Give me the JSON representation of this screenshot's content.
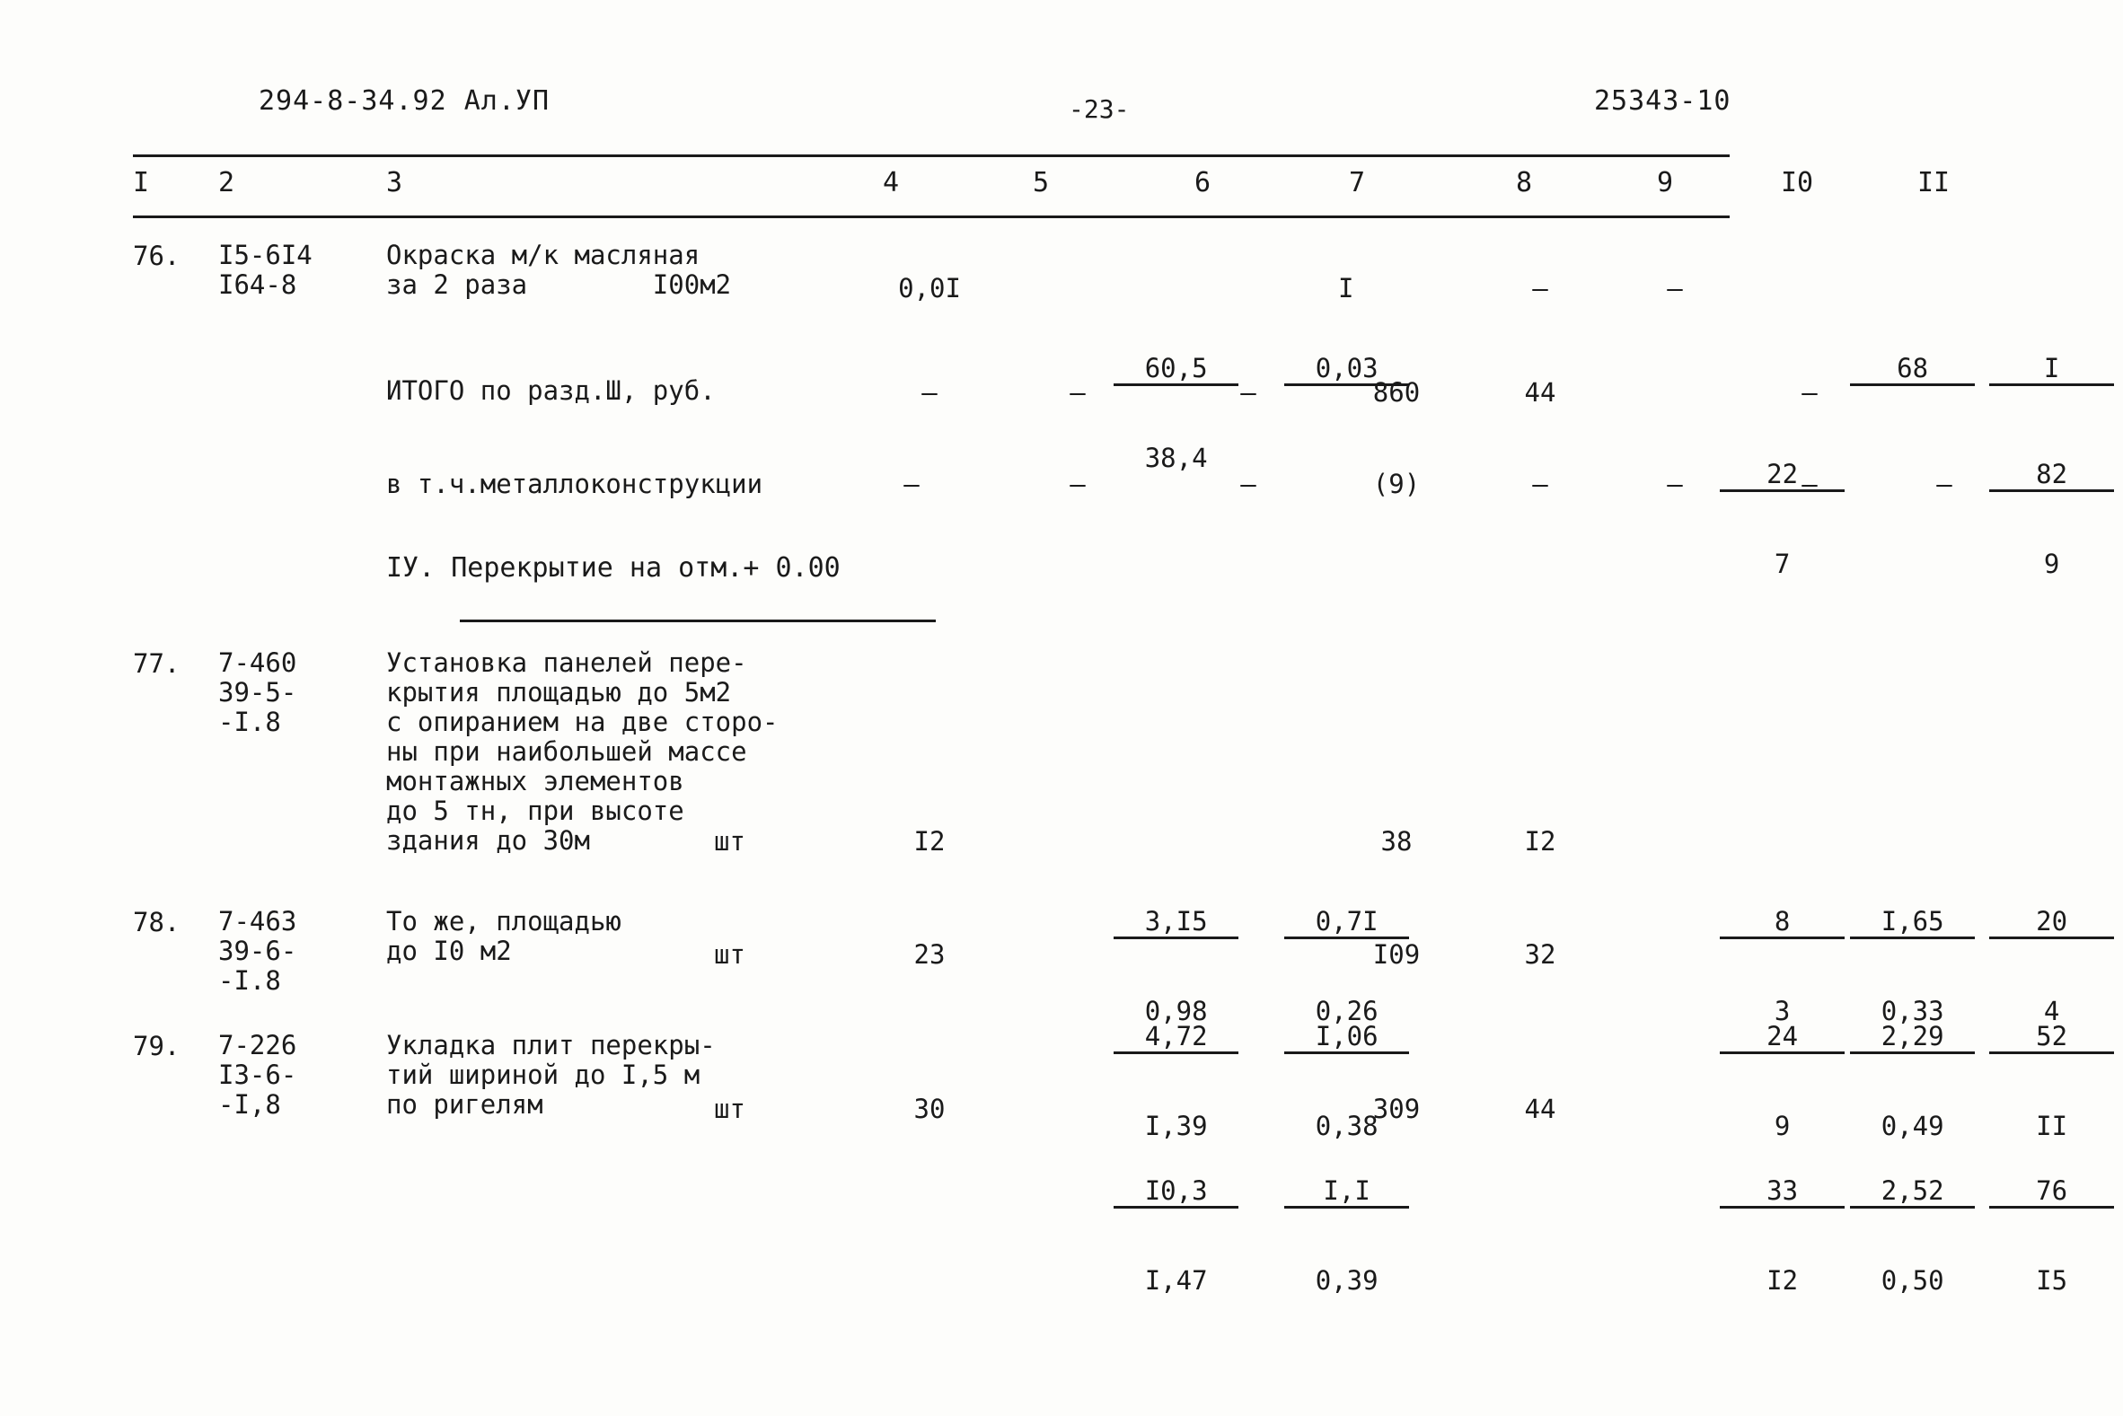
{
  "header": {
    "left": "294-8-34.92  Ал.УП",
    "page": "-23-",
    "right": "25343-10"
  },
  "column_numbers": [
    "I",
    "2",
    "3",
    "4",
    "5",
    "6",
    "7",
    "8",
    "9",
    "I0",
    "II"
  ],
  "rows": [
    {
      "num": "76.",
      "code": "I5-6I4\nI64-8",
      "desc": "Окраска м/к масляная\nза 2 раза        I00м2",
      "c4": "0,0I",
      "c5_num": "60,5",
      "c5_den": "38,4",
      "c6_num": "0,03",
      "c6_den": "",
      "c7": "I",
      "c8": "–",
      "c9": "–",
      "c10_num": "68",
      "c10_den": "",
      "c11_num": "I",
      "c11_den": ""
    },
    {
      "num": "",
      "code": "",
      "desc": "ИТОГО по разд.Ш, руб.",
      "c4": "–",
      "c5_num": "–",
      "c5_den": "",
      "c6_num": "–",
      "c6_den": "",
      "c7": "860",
      "c8": "44",
      "c9_num": "22",
      "c9_den": "7",
      "c10_num": "–",
      "c10_den": "",
      "c11_num": "82",
      "c11_den": "9"
    },
    {
      "num": "",
      "code": "",
      "desc": "в т.ч.металлоконструкции",
      "c4": "–",
      "c5_num": "–",
      "c6_num": "–",
      "c7": "(9)",
      "c8": "–",
      "c9_num": "–",
      "c10_num": "–",
      "c11_num": "–"
    }
  ],
  "section_heading": "IУ. Перекрытие на отм.+ 0.00",
  "rows2": [
    {
      "num": "77.",
      "code": "7-460\n39-5-\n-I.8",
      "desc": "Установка панелей пере-\nкрытия площадью до 5м2\nс опиранием на две сторо-\nны при наибольшей массе\nмонтажных элементов\nдо 5 тн, при высоте\nздания до 30м",
      "unit": "шт",
      "c4": "I2",
      "c5_num": "3,I5",
      "c5_den": "0,98",
      "c6_num": "0,7I",
      "c6_den": "0,26",
      "c7": "38",
      "c8": "I2",
      "c9_num": "8",
      "c9_den": "3",
      "c10_num": "I,65",
      "c10_den": "0,33",
      "c11_num": "20",
      "c11_den": "4"
    },
    {
      "num": "78.",
      "code": "7-463\n39-6-\n-I.8",
      "desc": "То же, площадью\nдо I0 м2",
      "unit": "шт",
      "c4": "23",
      "c5_num": "4,72",
      "c5_den": "I,39",
      "c6_num": "I,06",
      "c6_den": "0,38",
      "c7": "I09",
      "c8": "32",
      "c9_num": "24",
      "c9_den": "9",
      "c10_num": "2,29",
      "c10_den": "0,49",
      "c11_num": "52",
      "c11_den": "II"
    },
    {
      "num": "79.",
      "code": "7-226\nI3-6-\n-I,8",
      "desc": "Укладка плит перекры-\nтий шириной до I,5 м\nпо ригелям",
      "unit": "шт",
      "c4": "30",
      "c5_num": "I0,3",
      "c5_den": "I,47",
      "c6_num": "I,I",
      "c6_den": "0,39",
      "c7": "309",
      "c8": "44",
      "c9_num": "33",
      "c9_den": "I2",
      "c10_num": "2,52",
      "c10_den": "0,50",
      "c11_num": "76",
      "c11_den": "I5"
    }
  ]
}
